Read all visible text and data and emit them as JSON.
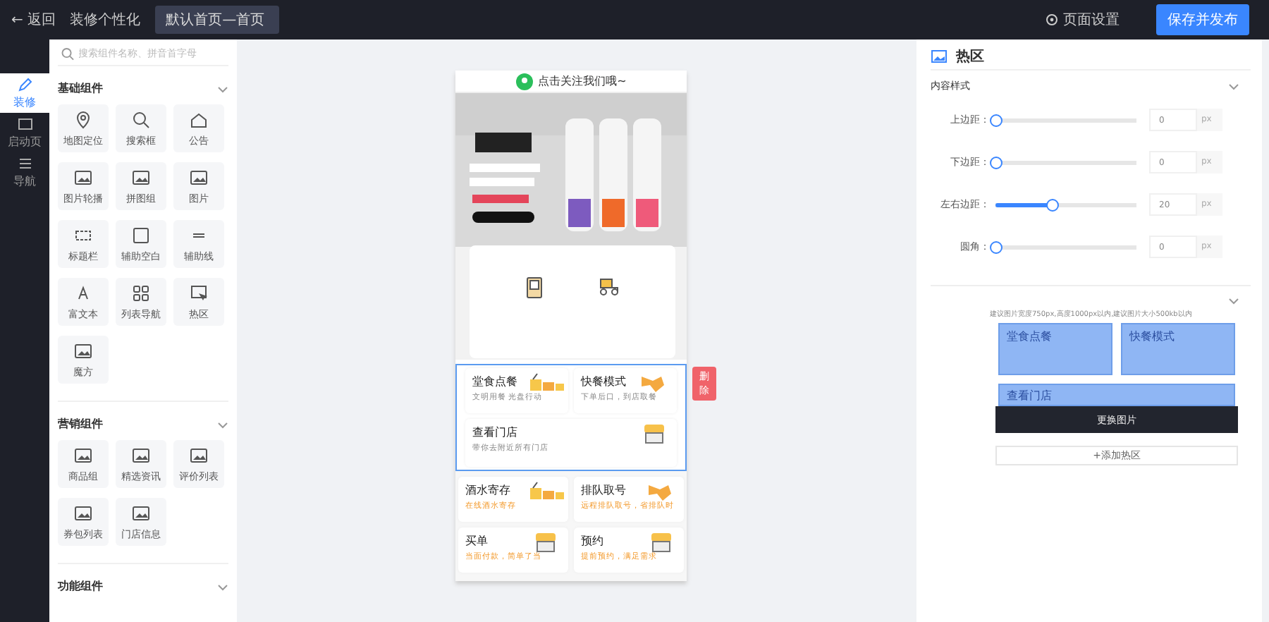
{
  "topbar": {
    "back": "← 返回",
    "title": "装修个性化",
    "page_field": "默认首页—首页",
    "settings": "页面设置",
    "publish": "保存并发布"
  },
  "rail": [
    {
      "label": "装修",
      "selected": true
    },
    {
      "label": "启动页",
      "selected": false
    },
    {
      "label": "导航",
      "selected": false
    }
  ],
  "component_panel": {
    "search_placeholder": "搜索组件名称、拼音首字母",
    "sections": [
      {
        "title": "基础组件",
        "expanded": true,
        "items": [
          "地图定位",
          "搜索框",
          "公告",
          "图片轮播",
          "拼图组",
          "图片",
          "标题栏",
          "辅助空白",
          "辅助线",
          "富文本",
          "列表导航",
          "热区",
          "魔方"
        ]
      },
      {
        "title": "营销组件",
        "expanded": true,
        "items": [
          "商品组",
          "精选资讯",
          "评价列表",
          "券包列表",
          "门店信息"
        ]
      },
      {
        "title": "功能组件",
        "expanded": true
      }
    ]
  },
  "phone": {
    "notice": "点击关注我们哦~",
    "hotzone": {
      "selected": true,
      "delete": "删除",
      "cards": [
        {
          "title": "堂食点餐",
          "subtitle": "文明用餐 光盘行动"
        },
        {
          "title": "快餐模式",
          "subtitle": "下单后口，到店取餐"
        },
        {
          "title": "查看门店",
          "subtitle": "带你去附近所有门店"
        }
      ]
    },
    "cards": [
      {
        "title": "酒水寄存",
        "subtitle": "在线酒水寄存"
      },
      {
        "title": "排队取号",
        "subtitle": "远程排队取号，省排队时"
      },
      {
        "title": "买单",
        "subtitle": "当面付款，简单了当"
      },
      {
        "title": "预约",
        "subtitle": "提前预约，满足需求"
      }
    ]
  },
  "settings_panel": {
    "title": "热区",
    "style_section": {
      "title": "内容样式",
      "expanded": true,
      "sliders": [
        {
          "label": "上边距：",
          "level": 0,
          "value": "0",
          "unit": "px"
        },
        {
          "label": "下边距：",
          "level": 0,
          "value": "0",
          "unit": "px"
        },
        {
          "label": "左右边距：",
          "level": 0.4,
          "value": "20",
          "unit": "px"
        },
        {
          "label": "圆角：",
          "level": 0,
          "value": "0",
          "unit": "px"
        }
      ]
    },
    "hint": "建议图片宽度750px,高度1000px以内,建议图片大小500kb以内",
    "preview_cards": [
      {
        "title": "堂食点餐"
      },
      {
        "title": "快餐模式"
      },
      {
        "title": "查看门店"
      }
    ],
    "change_image": "更换图片",
    "add_zone": "+添加热区"
  }
}
